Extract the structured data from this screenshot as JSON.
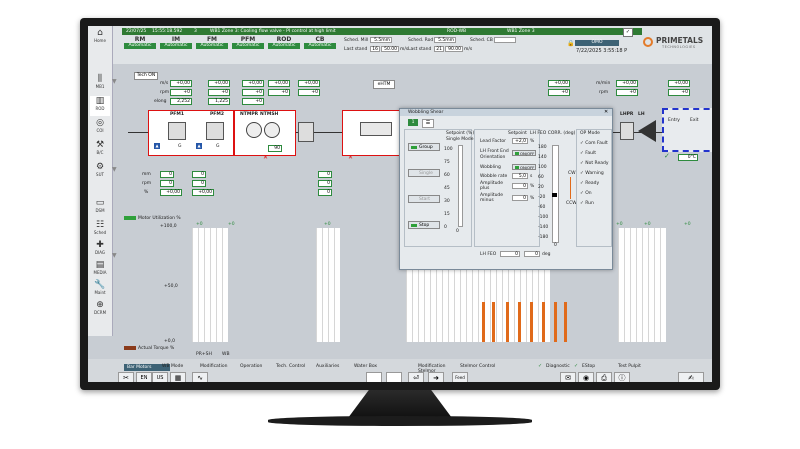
{
  "header": {
    "date": "22/07/25",
    "time": "15:55:18.592",
    "alarm_count": "3",
    "alarm_message": "WB1 Zone 3: Cooling flow valve - PI control at high limit",
    "rod_label": "ROD-WB",
    "zone_label": "WB1 Zone 3",
    "user": "OMO",
    "datetime": "7/22/2025 3:55:18 P",
    "logo_text": "PRIMETALS",
    "logo_sub": "TECHNOLOGIES"
  },
  "modes": [
    {
      "label": "RM",
      "value": "Automatic"
    },
    {
      "label": "IM",
      "value": "Automatic"
    },
    {
      "label": "FM",
      "value": "Automatic"
    },
    {
      "label": "PFM",
      "value": "Automatic"
    },
    {
      "label": "ROD",
      "value": "Automatic"
    },
    {
      "label": "CB",
      "value": "Automatic"
    }
  ],
  "sched": {
    "mill_label": "Sched. Mill",
    "mill_value": "5.5mm",
    "rod_label": "Sched. Rod",
    "rod_value": "5.5mm",
    "cb_label": "Sched. CB",
    "last_stand_label": "Last stand",
    "last_stand_value": "16",
    "speed_value": "50.00",
    "speed_unit": "m/s",
    "last_stand2_value": "21",
    "speed2_value": "90.00"
  },
  "nav": [
    {
      "label": "Home"
    },
    {
      "label": "MB1"
    },
    {
      "label": "ROD"
    },
    {
      "label": "COI"
    },
    {
      "label": "B/C"
    },
    {
      "label": "SUT"
    },
    {
      "label": "DSM"
    },
    {
      "label": "Sched"
    },
    {
      "label": "DIAG"
    },
    {
      "label": "MEDIA"
    },
    {
      "label": "Maint"
    },
    {
      "label": "DCRM"
    }
  ],
  "process": {
    "tech_on": "Tech ON",
    "rows": [
      "m/s",
      "rpm",
      "elong"
    ],
    "values_col1": [
      "+0,00",
      "+0",
      "2,252"
    ],
    "values_col2": [
      "+0,00",
      "+0",
      "1,225"
    ],
    "values_col3": [
      "+0,00",
      "+0",
      "+0"
    ],
    "values_col4": [
      "+0,00",
      "+0",
      "+0"
    ],
    "ehtm": "eHTM",
    "right_vals": [
      "+0,00",
      "+0"
    ],
    "mmin": "m/min",
    "rpm": "rpm",
    "right_col": [
      "+0,00",
      "+0"
    ],
    "stands": [
      "PFM1",
      "PFM2",
      "NTMPR",
      "NTMSH",
      "LH",
      "LHPR"
    ],
    "entry": "Entry",
    "exit": "Exit",
    "temp": "0°C",
    "g": "G",
    "ntm_val": "90"
  },
  "lower": {
    "rows": [
      "mm",
      "rpm",
      "%"
    ],
    "vals_a": [
      "0",
      "0",
      "+0,00"
    ],
    "vals_b": [
      "0",
      "0",
      "+0,00"
    ],
    "motor_util": "Motor Utilization %",
    "actual_torque": "Actual Torque %",
    "ticks": [
      "+100,0",
      "+50,0",
      "+0,0"
    ],
    "zero": "+0",
    "pr_sh": "PR+SH",
    "wb": "WB"
  },
  "dialog": {
    "title": "Wobbling Shear",
    "tab1": "1",
    "setpoint_label": "Setpoint (%)",
    "setpoint_sub": "Single Mode",
    "scale": [
      "100",
      "75",
      "60",
      "45",
      "30",
      "15",
      "0"
    ],
    "btn_group": "Group",
    "btn_single": "Single",
    "btn_start": "Start",
    "btn_stop": "Stop",
    "stop_val": "0",
    "lead_factor": "Lead Factor",
    "lead_val": "+2,0",
    "lh_front": "LH Front End",
    "orientation": "Orientation",
    "onoff": "ON/OFF",
    "wobbling": "Wobbling",
    "wobble_rate": "Wobble rate",
    "wobble_rate_val": "5,0",
    "amp_plus": "Amplitude plus",
    "amp_plus_val": "0",
    "amp_minus": "Amplitude minus",
    "amp_minus_val": "0",
    "setpoint": "Setpoint",
    "lh_feo_corr": "LH FEO CORR. (deg)",
    "feo_scale": [
      "180",
      "140",
      "100",
      "60",
      "20",
      "-20",
      "-60",
      "-100",
      "-140",
      "-180"
    ],
    "cw": "CW",
    "ccw": "CCW",
    "feo_val": "0",
    "lh_feo": "LH FEO",
    "lh_feo_val": "0",
    "deg": "deg",
    "op_mode": "OP Mode",
    "checks": [
      "Com Fault",
      "Fault",
      "Not Ready",
      "Warning",
      "Ready",
      "On",
      "Run"
    ]
  },
  "bottom_tabs": [
    "Bar Motors",
    "WB Mode",
    "Modification",
    "Operation",
    "Tech. Control",
    "Auxiliaries",
    "Water Box",
    "Modification Stelmor",
    "Stelmor Control"
  ],
  "status": [
    "Diagnostic",
    "EStop",
    "Test Pulpit"
  ],
  "lang": [
    "EN",
    "US"
  ],
  "feed": "Feed"
}
